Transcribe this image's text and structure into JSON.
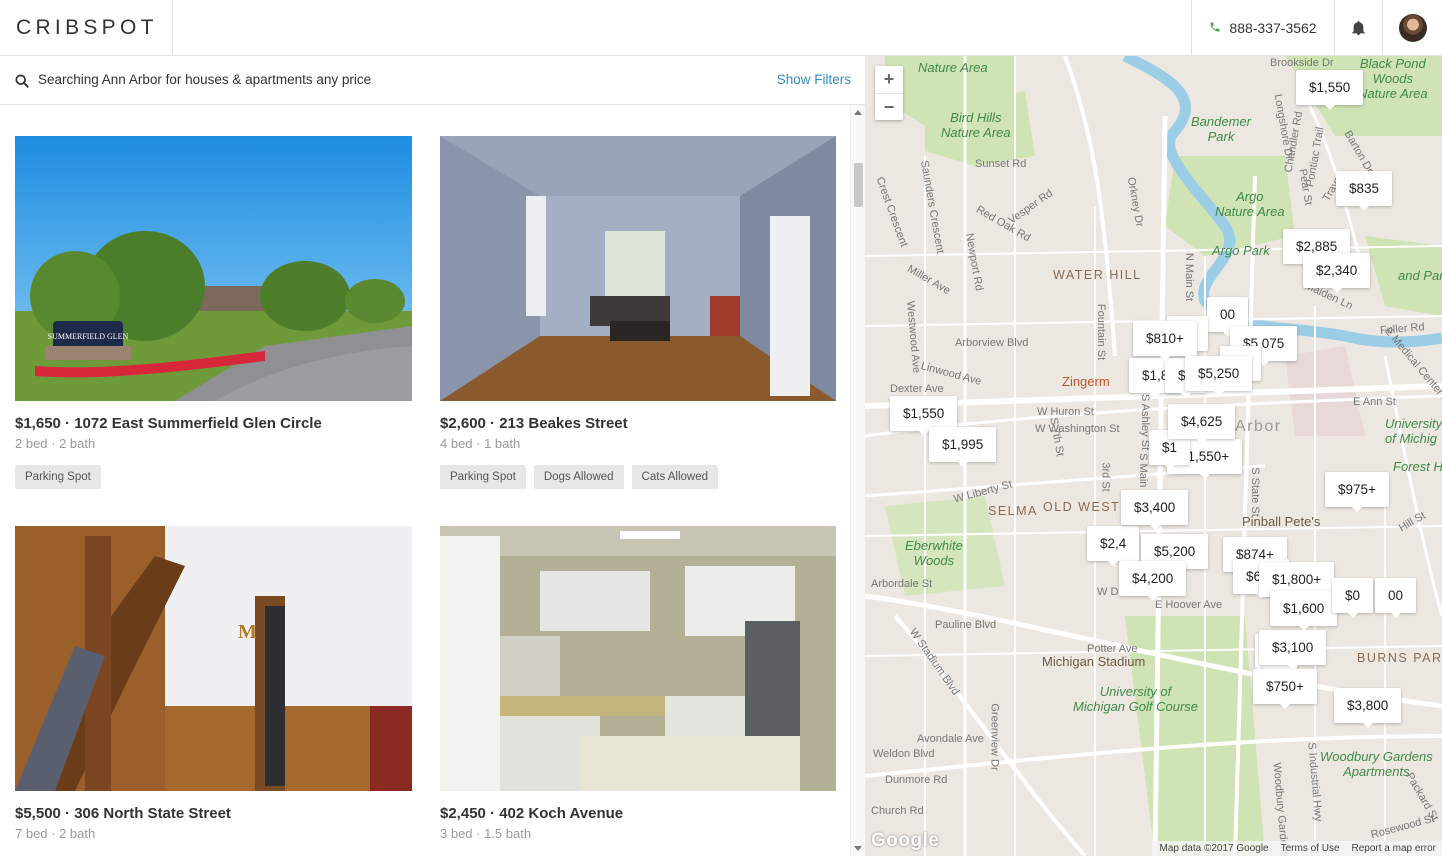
{
  "header": {
    "logo": "CRIBSPOT",
    "phone": "888-337-3562"
  },
  "search": {
    "summary": "Searching Ann Arbor for houses & apartments any price",
    "filters_label": "Show Filters"
  },
  "listings": [
    {
      "title": "$1,650 · 1072 East Summerfield Glen Circle",
      "details": "2 bed · 2 bath",
      "tags": [
        "Parking Spot"
      ]
    },
    {
      "title": "$2,600 · 213 Beakes Street",
      "details": "4 bed · 1 bath",
      "tags": [
        "Parking Spot",
        "Dogs Allowed",
        "Cats Allowed"
      ]
    },
    {
      "title": "$5,500 · 306 North State Street",
      "details": "7 bed · 2 bath",
      "tags": []
    },
    {
      "title": "$2,450 · 402 Koch Avenue",
      "details": "3 bed · 1.5 bath",
      "tags": []
    }
  ],
  "photo_signs": {
    "summerfield": "SUMMERFIELD GLEN",
    "letter_m": "M"
  },
  "map": {
    "zoom_in": "+",
    "zoom_out": "−",
    "pins": [
      "$1,550",
      "$835",
      "$2,885",
      "$2,340",
      "$810+",
      "$5,250",
      "$4,625",
      "$1,550",
      "$1,995",
      "$975+",
      "$3,400",
      "$5,200",
      "$4,200",
      "$1,800+",
      "$1,600",
      "$0",
      "$3,100",
      "$750+",
      "$3,800"
    ],
    "partial_pins": [
      "00",
      "$5,075",
      "00",
      "05",
      "$1,8",
      "$1",
      "$1,550+",
      "$2,4",
      "$874+",
      "$625",
      "5",
      "$1",
      "0",
      "00"
    ],
    "area_labels": [
      "WATER HILL",
      "SELMA",
      "OLD WEST",
      "BURNS PAR",
      "Arbor"
    ],
    "park_labels": [
      "Nature Area",
      "Bird Hills\nNature Area",
      "Argo\nNature Area",
      "Argo Park",
      "Eberwhite\nWoods",
      "University of\nMichigan Golf Course",
      "Woodbury Gardens\nApartments",
      "Forest H",
      "Black Pond\nWoods\nNature Area",
      "and Park",
      "University\nof Michig"
    ],
    "poi_labels": [
      "Zingerm",
      "Pinball Pete's",
      "Michigan Stadium"
    ],
    "streets": [
      "Sunset Rd",
      "Red Oak Rd",
      "Vesper Rd",
      "Miller Ave",
      "Newport Rd",
      "Arborview Blvd",
      "Linwood Ave",
      "Dexter Ave",
      "W Huron St",
      "W Washington St",
      "W Liberty St",
      "Pauline Blvd",
      "W Stadium Blvd",
      "Potter Ave",
      "Avondale Ave",
      "Weldon Blvd",
      "Dunmore Rd",
      "Church Rd",
      "Greenview Dr",
      "E Hoover Ave",
      "W Davis",
      "Arbordale St",
      "Fountain St",
      "N Main St",
      "Orkney Dr",
      "Maiden Ln",
      "Fuller Rd",
      "E Medical Center Dr",
      "E Ann St",
      "Hill St",
      "S State St",
      "S Industrial Hwy",
      "Packard St",
      "Rosewood St",
      "Westwood Ave",
      "Saunders Crescent",
      "Crest Crescent",
      "Pontiac Trail",
      "Pear St",
      "Chandler Rd",
      "Longshore Dr",
      "Barton Dr",
      "Brookside Dr",
      "Traver",
      "Bandemer\nPark",
      "S 7th St",
      "3rd St",
      "S Main St",
      "Woodbury Gardens",
      "S Ashley St"
    ],
    "google_logo": "Google",
    "footer": [
      "Map data ©2017 Google",
      "Terms of Use",
      "Report a map error"
    ]
  }
}
